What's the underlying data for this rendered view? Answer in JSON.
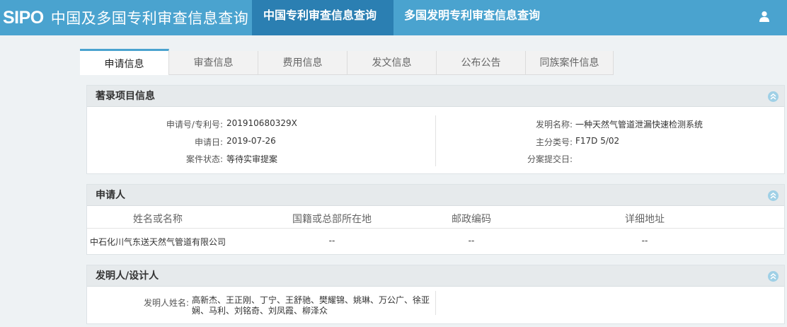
{
  "header": {
    "logo_mark": "SIPO",
    "logo_text": "中国及多国专利审查信息查询",
    "nav": [
      {
        "label": "中国专利审查信息查询",
        "active": true
      },
      {
        "label": "多国发明专利审查信息查询",
        "active": false
      }
    ],
    "user_icon": "user-icon"
  },
  "subtabs": [
    "申请信息",
    "审查信息",
    "费用信息",
    "发文信息",
    "公布公告",
    "同族案件信息"
  ],
  "bibliographic": {
    "title": "著录项目信息",
    "app_no_label": "申请号/专利号:",
    "app_no": "201910680329X",
    "app_date_label": "申请日:",
    "app_date": "2019-07-26",
    "status_label": "案件状态:",
    "status": "等待实审提案",
    "invention_name_label": "发明名称:",
    "invention_name": "一种天然气管道泄漏快速检测系统",
    "main_class_label": "主分类号:",
    "main_class": "F17D 5/02",
    "divisional_date_label": "分案提交日:",
    "divisional_date": ""
  },
  "applicant": {
    "title": "申请人",
    "columns": [
      "姓名或名称",
      "国籍或总部所在地",
      "邮政编码",
      "详细地址"
    ],
    "rows": [
      [
        "中石化川气东送天然气管道有限公司",
        "--",
        "--",
        "--"
      ]
    ]
  },
  "inventor": {
    "title": "发明人/设计人",
    "label": "发明人姓名:",
    "line1": "高新杰、王正刚、丁宁、王舒驰、樊耀锦、姚琳、万公广、徐亚",
    "line2": "娴、马利、刘铭奇、刘凤霞、柳泽众"
  },
  "colors": {
    "topbar": "#4aa3cf",
    "topbar_active": "#2b7fb2",
    "page_bg": "#eef2f4",
    "panel_head": "#e6eaec"
  }
}
